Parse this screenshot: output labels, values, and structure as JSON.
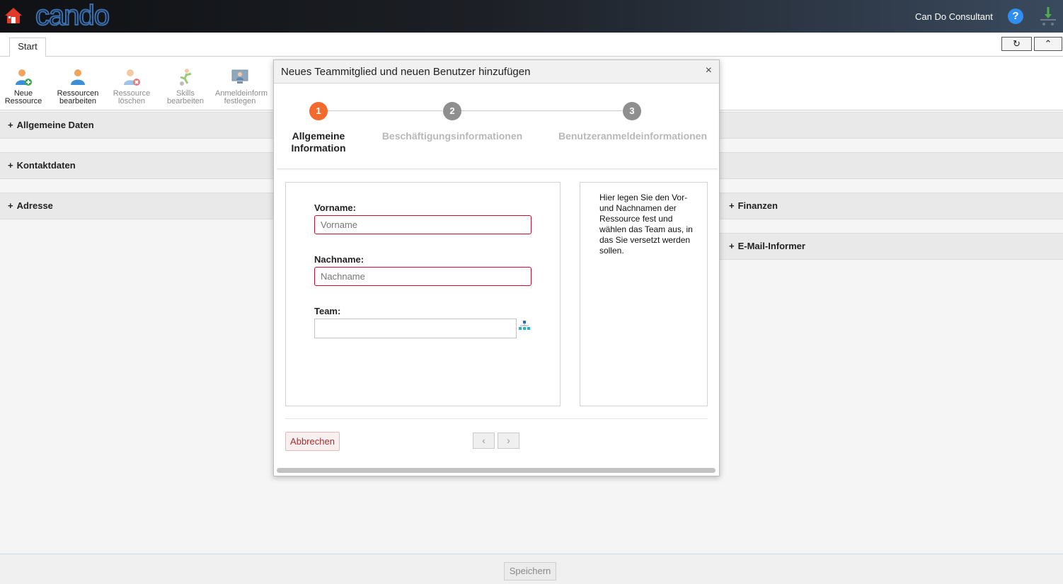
{
  "app": {
    "logo_text": "cando",
    "user_name": "Can Do Consultant",
    "help_label": "?"
  },
  "tabs": [
    {
      "label": "Start"
    }
  ],
  "toolbar": {
    "refresh_label": "↻",
    "collapse_label": "⌃"
  },
  "ribbon": {
    "items": [
      {
        "line1": "Neue",
        "line2": "Ressource",
        "icon": "add-user-icon",
        "enabled": true
      },
      {
        "line1": "Ressourcen",
        "line2": "bearbeiten",
        "icon": "edit-user-icon",
        "enabled": true
      },
      {
        "line1": "Ressource",
        "line2": "löschen",
        "icon": "delete-user-icon",
        "enabled": false
      },
      {
        "line1": "Skills",
        "line2": "bearbeiten",
        "icon": "skills-icon",
        "enabled": false
      },
      {
        "line1": "Anmeldeinform",
        "line2": "festlegen",
        "icon": "login-monitor-icon",
        "enabled": false
      }
    ]
  },
  "sections": {
    "left": [
      "Allgemeine Daten",
      "Kontaktdaten",
      "Adresse"
    ],
    "right": [
      "Finanzen",
      "E-Mail-Informer"
    ],
    "expand_symbol": "+"
  },
  "footer": {
    "save_label": "Speichern"
  },
  "dialog": {
    "title": "Neues Teammitglied und neuen Benutzer hinzufügen",
    "close_label": "×",
    "steps": [
      {
        "number": "1",
        "label_line1": "Allgemeine",
        "label_line2": "Information",
        "active": true
      },
      {
        "number": "2",
        "label_line1": "Beschäftigungsinformationen",
        "label_line2": "",
        "active": false
      },
      {
        "number": "3",
        "label_line1": "Benutzeranmeldeinformationen",
        "label_line2": "",
        "active": false
      }
    ],
    "form": {
      "first_name_label": "Vorname:",
      "first_name_placeholder": "Vorname",
      "first_name_value": "",
      "last_name_label": "Nachname:",
      "last_name_placeholder": "Nachname",
      "last_name_value": "",
      "team_label": "Team:",
      "team_value": ""
    },
    "help_text": "Hier legen Sie den Vor- und Nachnamen der Ressource fest und wählen das Team aus, in das Sie versetzt werden sollen.",
    "cancel_label": "Abbrechen",
    "prev_label": "‹",
    "next_label": "›"
  },
  "colors": {
    "active_step": "#f26a2e",
    "inactive_step": "#8f8f8f",
    "inactive_step_text": "#b8b8b8",
    "invalid_border": "#c8102e",
    "accent_blue": "#2f8ef0"
  }
}
